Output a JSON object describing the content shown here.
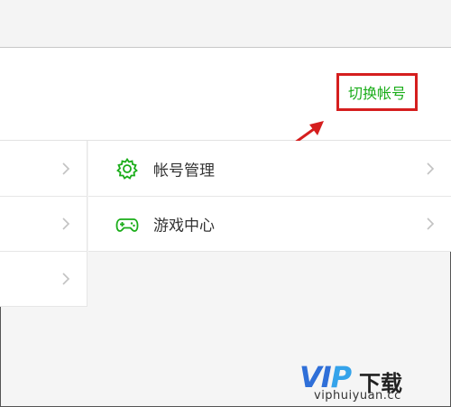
{
  "header": {
    "switch_account_label": "切换帐号"
  },
  "menu": {
    "right_items": [
      {
        "label": "帐号管理",
        "icon": "gear-icon"
      },
      {
        "label": "游戏中心",
        "icon": "gamepad-icon"
      }
    ]
  },
  "watermark": {
    "logo_part1": "VI",
    "logo_part2": "P",
    "logo_suffix": "下载",
    "url": "viphuiyuan.cc"
  },
  "colors": {
    "accent_green": "#1aad19",
    "highlight_red": "#d51e1e"
  }
}
